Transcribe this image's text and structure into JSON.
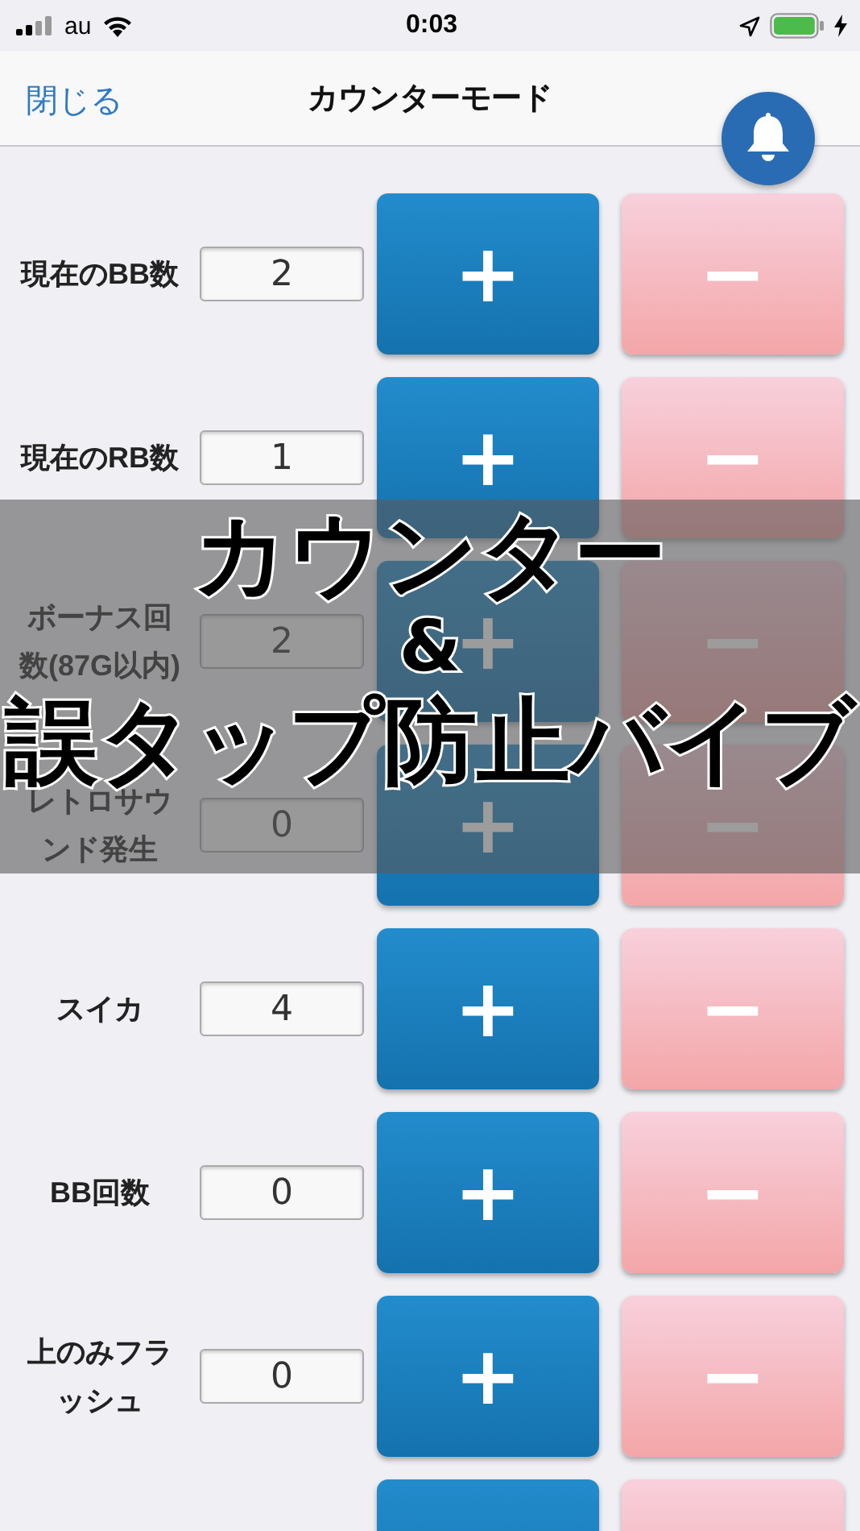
{
  "status_bar": {
    "carrier": "au",
    "time": "0:03"
  },
  "nav": {
    "close": "閉じる",
    "title": "カウンターモード"
  },
  "counters": [
    {
      "label": "現在のBB数",
      "value": "2",
      "plus": "+",
      "minus": "−"
    },
    {
      "label": "現在のRB数",
      "value": "1",
      "plus": "+",
      "minus": "−"
    },
    {
      "label": "ボーナス回数(87G以内)",
      "value": "2",
      "plus": "+",
      "minus": "−"
    },
    {
      "label": "レトロサウンド発生",
      "value": "0",
      "plus": "+",
      "minus": "−"
    },
    {
      "label": "スイカ",
      "value": "4",
      "plus": "+",
      "minus": "−"
    },
    {
      "label": "BB回数",
      "value": "0",
      "plus": "+",
      "minus": "−"
    },
    {
      "label": "上のみフラッシュ",
      "value": "0",
      "plus": "+",
      "minus": "−"
    }
  ],
  "list_continues": true,
  "banner": {
    "lines": [
      "カウンター",
      "&",
      "誤タップ防止バイブ"
    ]
  }
}
